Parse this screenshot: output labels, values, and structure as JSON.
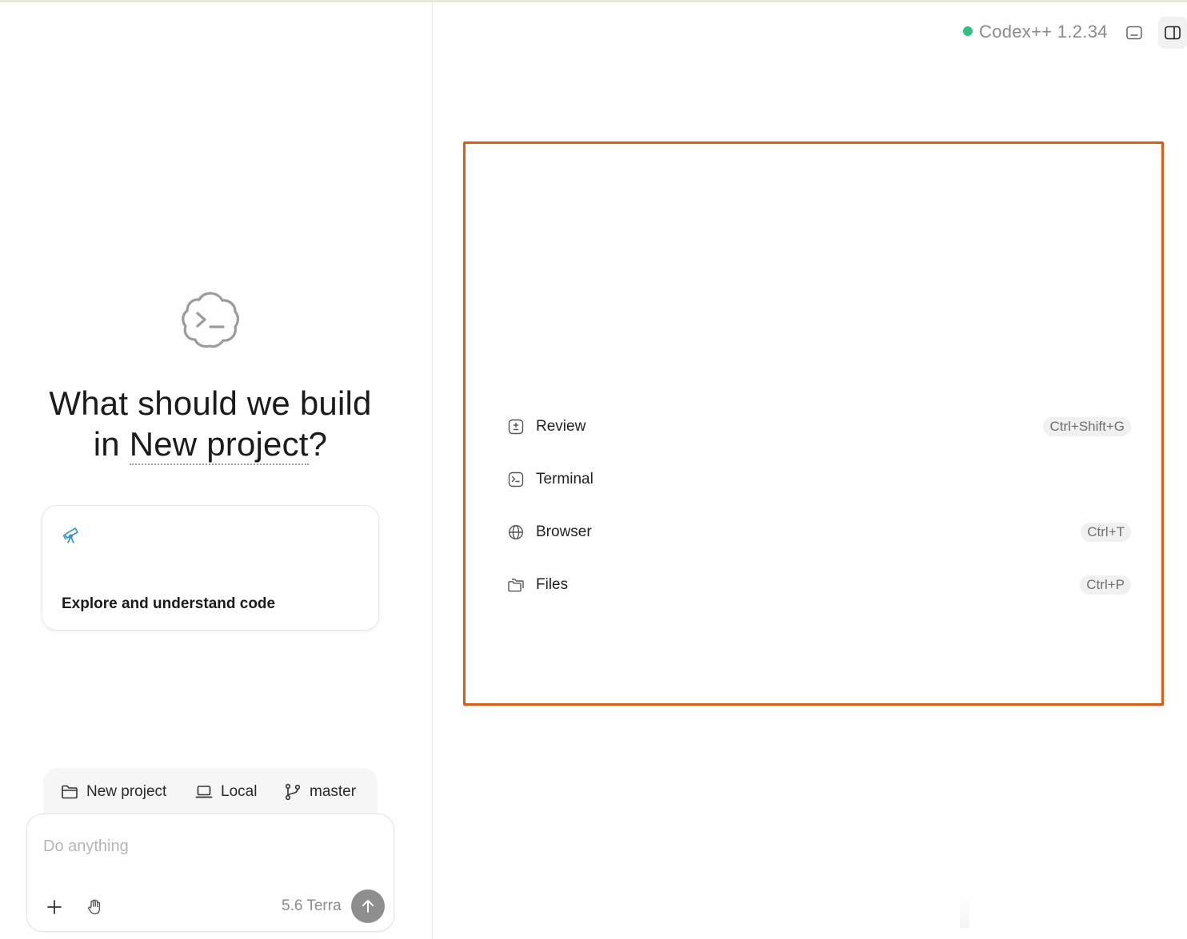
{
  "app": {
    "version_label": "Codex++ 1.2.34",
    "status_color": "#2ec27e",
    "accent_highlight": "#e8590c"
  },
  "hero": {
    "title_line1": "What should we build",
    "title_prefix": "in ",
    "project_name": "New project",
    "title_suffix": "?"
  },
  "suggestion": {
    "icon": "telescope-icon",
    "label": "Explore and understand code"
  },
  "context": {
    "project": {
      "icon": "folder-icon",
      "label": "New project"
    },
    "environment": {
      "icon": "laptop-icon",
      "label": "Local"
    },
    "branch": {
      "icon": "git-branch-icon",
      "label": "master"
    }
  },
  "composer": {
    "placeholder": "Do anything",
    "model": "5.6 Terra"
  },
  "panel_menu": [
    {
      "icon": "review-icon",
      "label": "Review",
      "shortcut": "Ctrl+Shift+G"
    },
    {
      "icon": "terminal-icon",
      "label": "Terminal",
      "shortcut": ""
    },
    {
      "icon": "globe-icon",
      "label": "Browser",
      "shortcut": "Ctrl+T"
    },
    {
      "icon": "files-icon",
      "label": "Files",
      "shortcut": "Ctrl+P"
    }
  ]
}
